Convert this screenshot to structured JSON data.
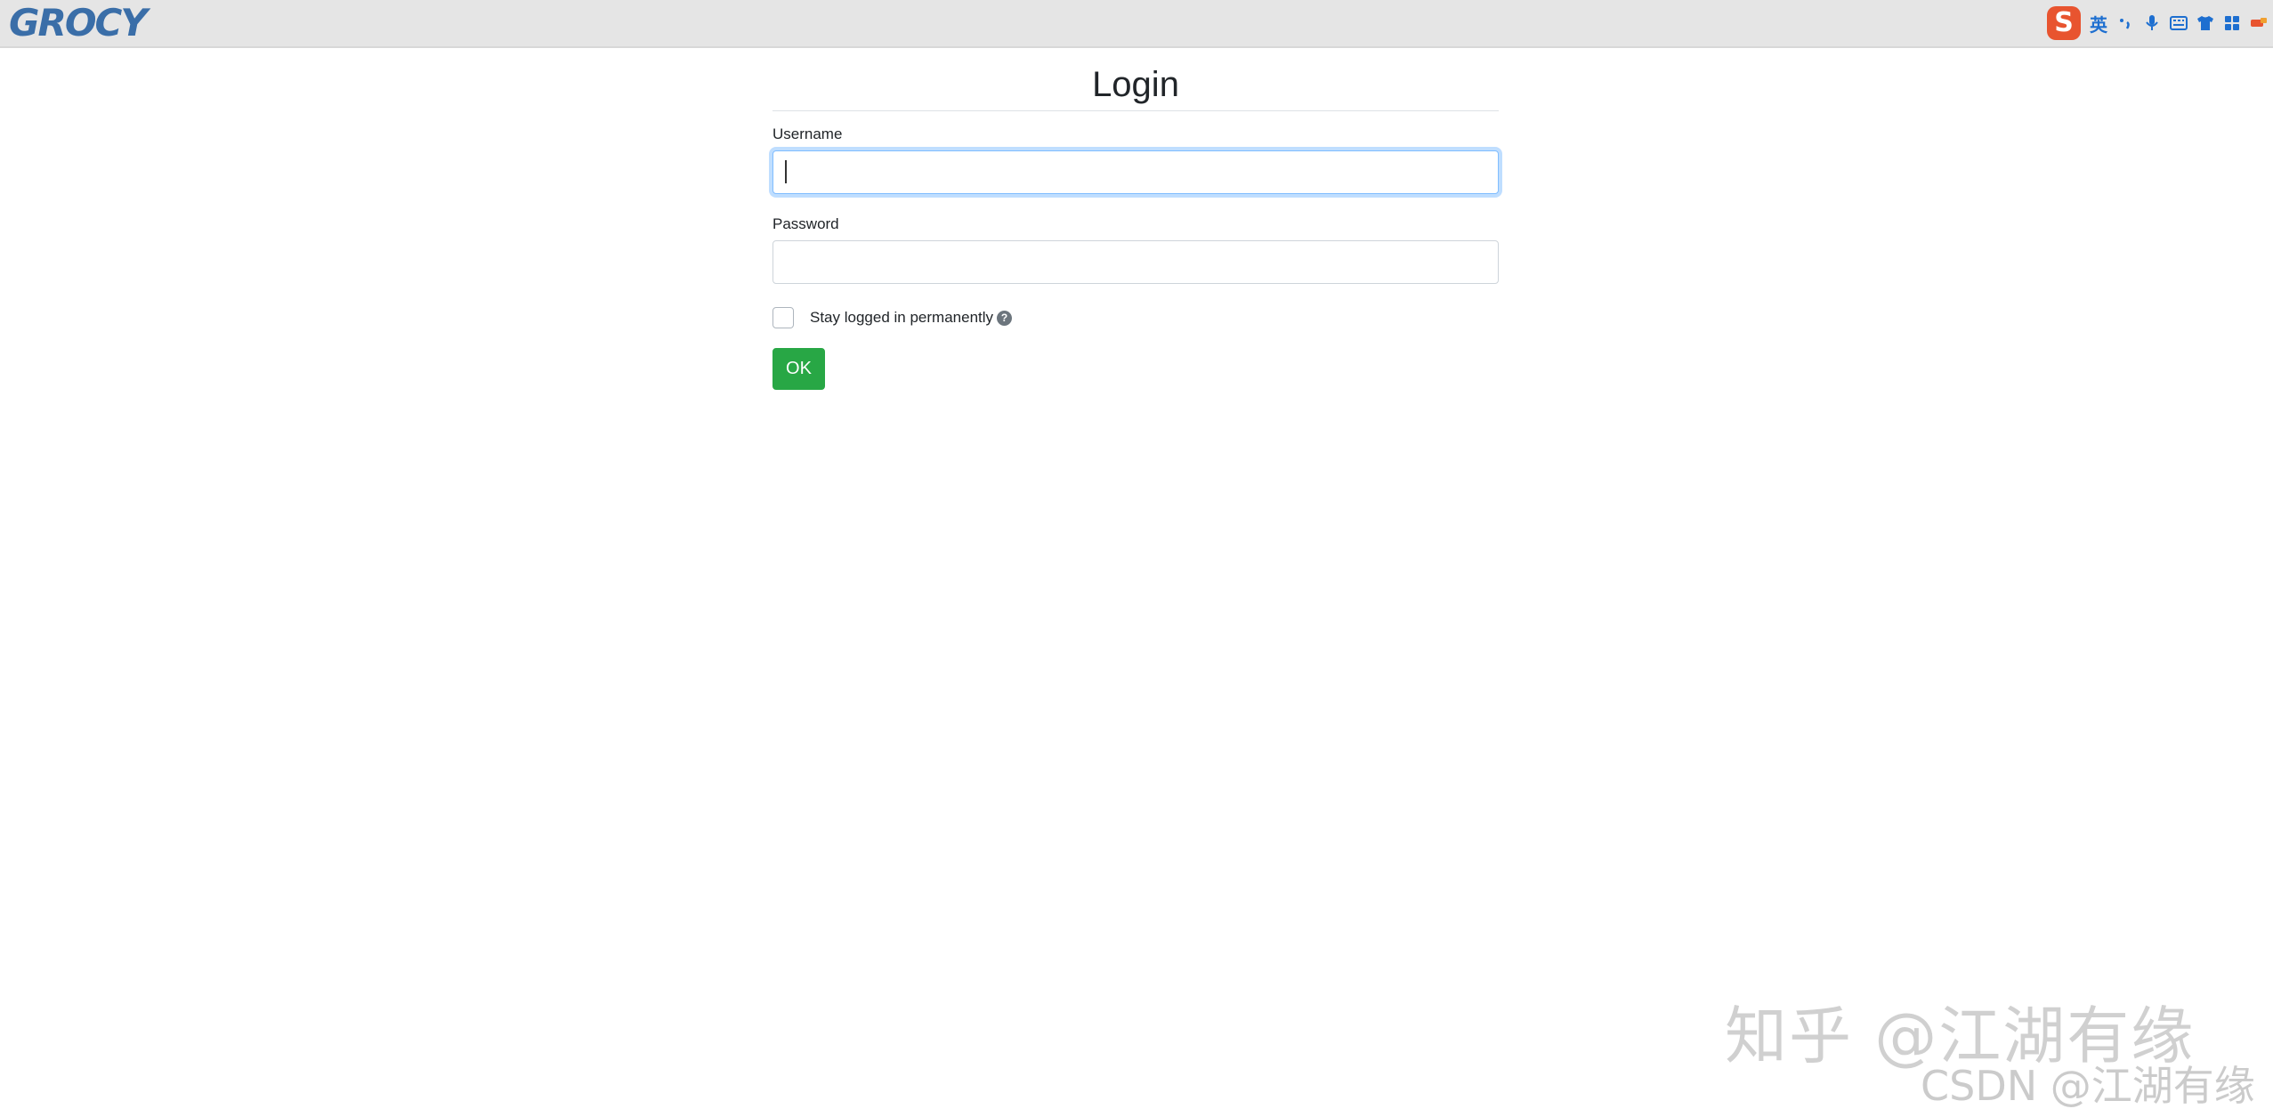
{
  "header": {
    "brand": "GROCY",
    "ime": {
      "mode_label": "英",
      "icons": [
        "punctuation-icon",
        "microphone-icon",
        "keyboard-icon",
        "skin-icon",
        "toolbox-icon",
        "more-icon"
      ]
    }
  },
  "login": {
    "title": "Login",
    "username_label": "Username",
    "username_value": "",
    "password_label": "Password",
    "password_value": "",
    "stay_logged_in_label": "Stay logged in permanently",
    "help_glyph": "?",
    "ok_label": "OK"
  },
  "watermarks": {
    "zhihu": "知乎 @江湖有缘",
    "csdn": "CSDN @江湖有缘"
  },
  "colors": {
    "brand": "#3a6ea8",
    "ok_button": "#28a745",
    "focus_border": "#80bdff",
    "ime_logo": "#e8542f"
  }
}
